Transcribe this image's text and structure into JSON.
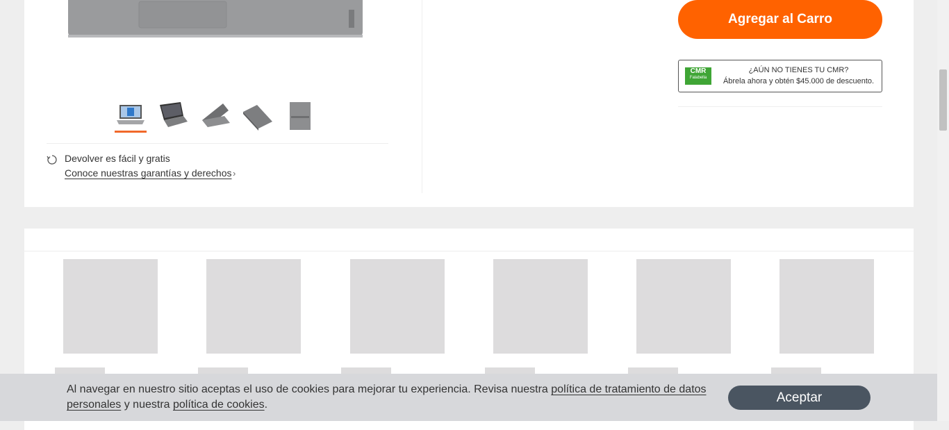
{
  "product": {
    "add_to_cart_label": "Agregar al Carro",
    "cmr_promo": {
      "logo_text": "CMR",
      "logo_sub": "Falabella",
      "title": "¿AÚN NO TIENES TU CMR?",
      "subtitle": "Ábrela ahora y obtén $45.000 de descuento."
    },
    "returns": {
      "line1": "Devolver es fácil y gratis",
      "link": "Conoce nuestras garantías y derechos"
    },
    "thumbnails": [
      "laptop-front-thumbnail",
      "laptop-angle-thumbnail",
      "laptop-side-thumbnail",
      "laptop-folded-thumbnail",
      "laptop-lid-thumbnail"
    ],
    "active_thumbnail": 0
  },
  "cookie_bar": {
    "text_before": "Al navegar en nuestro sitio aceptas el uso de cookies para mejorar tu experiencia. Revisa nuestra ",
    "link1": "política de tratamiento de datos personales",
    "text_middle": " y nuestra ",
    "link2": "política de cookies",
    "text_after": ".",
    "accept_label": "Aceptar"
  },
  "colors": {
    "accent": "#ff6200",
    "cmr_green": "#3fa535",
    "accept_button": "#4a5561"
  }
}
